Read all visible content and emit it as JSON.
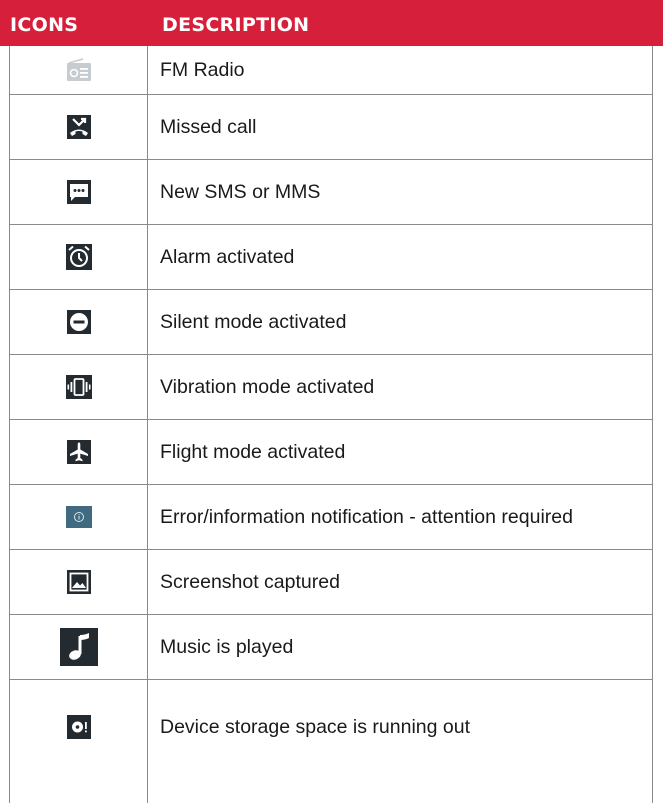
{
  "header": {
    "icons_label": "ICONS",
    "description_label": "DESCRIPTION"
  },
  "colors": {
    "header_bg": "#d61f3a",
    "border": "#8a8a8a",
    "icon_bg": "#232a30",
    "info_icon_bg": "#3f6a80"
  },
  "rows": [
    {
      "icon": "fm-radio-icon",
      "description": "FM Radio"
    },
    {
      "icon": "missed-call-icon",
      "description": "Missed call"
    },
    {
      "icon": "sms-icon",
      "description": "New SMS or MMS"
    },
    {
      "icon": "alarm-icon",
      "description": "Alarm activated"
    },
    {
      "icon": "silent-mode-icon",
      "description": "Silent mode activated"
    },
    {
      "icon": "vibration-icon",
      "description": "Vibration mode activated"
    },
    {
      "icon": "airplane-icon",
      "description": "Flight mode activated"
    },
    {
      "icon": "info-icon",
      "description": "Error/information notification -  attention required"
    },
    {
      "icon": "screenshot-icon",
      "description": "Screenshot captured"
    },
    {
      "icon": "music-note-icon",
      "description": "Music is played"
    },
    {
      "icon": "storage-warning-icon",
      "description": "Device storage space is running out"
    }
  ]
}
